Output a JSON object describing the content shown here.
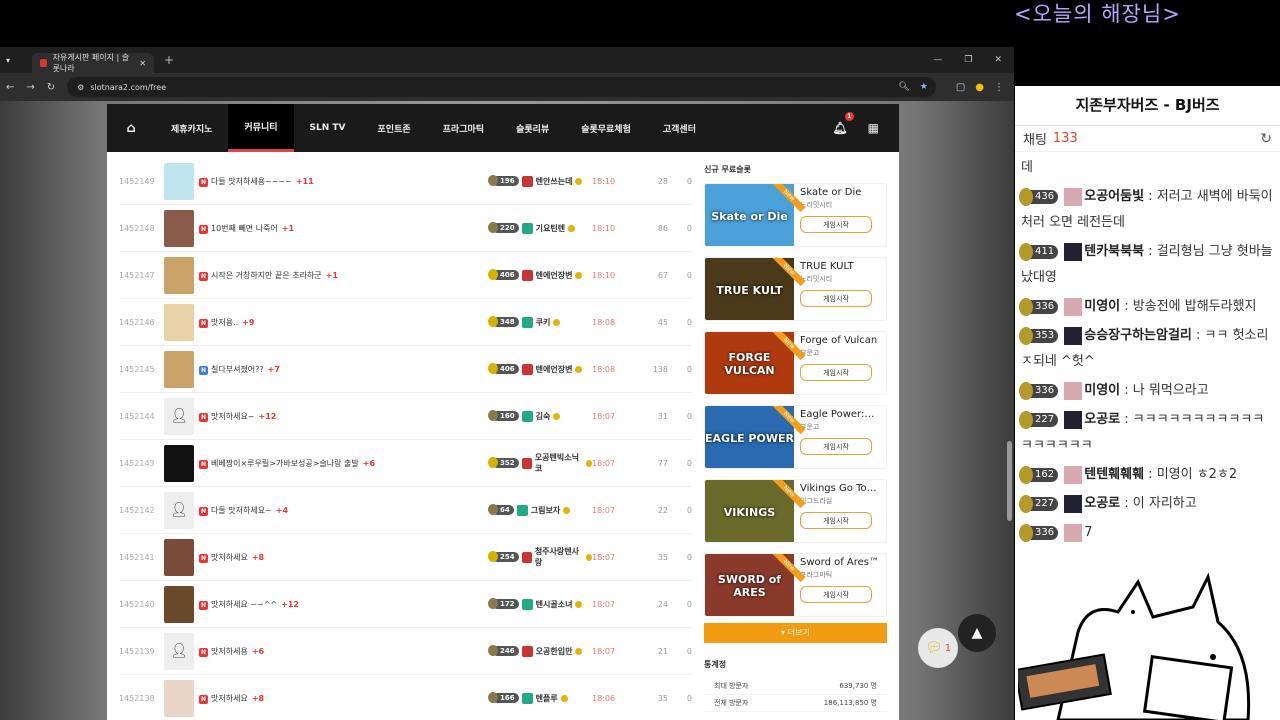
{
  "overlay": {
    "title": "<오늘의 해장님>"
  },
  "browser": {
    "tab_title": "자유게시판 페이지 | 슬롯나라",
    "url": "slotnara2.com/free"
  },
  "nav": {
    "items": [
      "제휴카지노",
      "커뮤니티",
      "SLN TV",
      "포인트존",
      "프라그마틱",
      "슬롯리뷰",
      "슬롯무료체험",
      "고객센터"
    ],
    "active": "커뮤니티",
    "bell_count": "1"
  },
  "posts": [
    {
      "num": "1452149",
      "badge": "N",
      "title": "다들 맛저하세용~~~~",
      "count": "+11",
      "level": "196",
      "author": "텐안쓰는데",
      "time": "18:10",
      "views": "28",
      "likes": "0",
      "thumb": "#bfe6ef"
    },
    {
      "num": "1452148",
      "badge": "N",
      "title": "10번째 뻬면 나죽어",
      "count": "+1",
      "level": "220",
      "author": "기요틴텐",
      "time": "18:10",
      "views": "86",
      "likes": "0",
      "thumb": "#8a5b4a"
    },
    {
      "num": "1452147",
      "badge": "N",
      "title": "시작은 거창하지만 끝은 초라하군",
      "count": "+1",
      "level": "406",
      "author": "텐에언장변",
      "time": "18:10",
      "views": "67",
      "likes": "0",
      "thumb": "#c9a36a"
    },
    {
      "num": "1452146",
      "badge": "N",
      "title": "맛저용..",
      "count": "+9",
      "level": "348",
      "author": "쿠키",
      "time": "18:08",
      "views": "45",
      "likes": "0",
      "thumb": "#e8d2a8"
    },
    {
      "num": "1452145",
      "badge": "N",
      "title": "칠다부셔졌어??",
      "count": "+7",
      "level": "406",
      "author": "텐에언장변",
      "time": "18:08",
      "views": "138",
      "likes": "0",
      "thumb": "#c9a36a",
      "blue": true
    },
    {
      "num": "1452144",
      "badge": "N",
      "title": "맛저하세요~",
      "count": "+12",
      "level": "160",
      "author": "김숙",
      "time": "18:07",
      "views": "31",
      "likes": "0",
      "thumb": "#eeeeee"
    },
    {
      "num": "1452143",
      "badge": "N",
      "title": "베베짱이×루우릴>가바보성공>슬나랑 출발",
      "count": "+6",
      "level": "352",
      "author": "오공텐빅소닉코",
      "time": "18:07",
      "views": "77",
      "likes": "0",
      "thumb": "#111111"
    },
    {
      "num": "1452142",
      "badge": "N",
      "title": "다들 맛저하세요~",
      "count": "+4",
      "level": "64",
      "author": "그림보자",
      "time": "18:07",
      "views": "22",
      "likes": "0",
      "thumb": "#eeeeee"
    },
    {
      "num": "1452141",
      "badge": "N",
      "title": "맛저하세요",
      "count": "+8",
      "level": "254",
      "author": "청주사랑텐사랑",
      "time": "18:07",
      "views": "35",
      "likes": "0",
      "thumb": "#7a4a3a"
    },
    {
      "num": "1452140",
      "badge": "N",
      "title": "맛저하세요 ~~^^",
      "count": "+12",
      "level": "172",
      "author": "텐시골소녀",
      "time": "18:07",
      "views": "24",
      "likes": "0",
      "thumb": "#6a4a2a"
    },
    {
      "num": "1452139",
      "badge": "N",
      "title": "맛저하세용",
      "count": "+6",
      "level": "246",
      "author": "오공한입만",
      "time": "18:07",
      "views": "21",
      "likes": "0",
      "thumb": "#eeeeee"
    },
    {
      "num": "1452138",
      "badge": "N",
      "title": "맛저하세요",
      "count": "+8",
      "level": "166",
      "author": "텐플루",
      "time": "18:06",
      "views": "35",
      "likes": "0",
      "thumb": "#e9d6c8"
    }
  ],
  "sidebar": {
    "heading": "신규 무료슬롯",
    "games": [
      {
        "name": "Skate or Die",
        "provider": "노리밋시티",
        "button": "게임시작",
        "art": "Skate or Die",
        "color": "#4aa0d8",
        "ribbon": "New"
      },
      {
        "name": "TRUE KULT",
        "provider": "노리밋시티",
        "button": "게임시작",
        "art": "TRUE KULT",
        "color": "#4a3a1a",
        "ribbon": "New"
      },
      {
        "name": "Forge of Vulcan",
        "provider": "부운고",
        "button": "게임시작",
        "art": "FORGE VULCAN",
        "color": "#b03a10",
        "ribbon": "New"
      },
      {
        "name": "Eagle Power:…",
        "provider": "부운고",
        "button": "게임시작",
        "art": "EAGLE POWER",
        "color": "#2a6ab0",
        "ribbon": "New"
      },
      {
        "name": "Vikings Go To…",
        "provider": "이그드라실",
        "button": "게임시작",
        "art": "VIKINGS",
        "color": "#6a6a2a",
        "ribbon": "New"
      },
      {
        "name": "Sword of Ares™",
        "provider": "프라그마틱",
        "button": "게임시작",
        "art": "SWORD of ARES",
        "color": "#8a3a2a",
        "ribbon": "New"
      }
    ],
    "more_label": "더보기",
    "stats_heading": "통계정",
    "stats": [
      {
        "label": "최대 방문자",
        "value": "639,730 명"
      },
      {
        "label": "전체 방문자",
        "value": "186,113,850 명"
      }
    ]
  },
  "chat_fab_count": "1",
  "chat": {
    "title": "지존부자버즈 - BJ버즈",
    "label": "채팅",
    "count": "133",
    "messages": [
      {
        "level": "",
        "nick": "",
        "text": "데"
      },
      {
        "level": "436",
        "nick": "오공어둠빛",
        "text": "저러고 새벽에 바둑이처러 오면 레전든데"
      },
      {
        "level": "411",
        "nick": "텐카북북북",
        "text": "걸리형님 그냥 혓바늘났대영"
      },
      {
        "level": "336",
        "nick": "미영이",
        "text": "방송전에 밥해두라했지"
      },
      {
        "level": "353",
        "nick": "승승장구하는암걸리",
        "text": "ㅋㅋ 헛소리 ㅈ되네 ^헛^"
      },
      {
        "level": "336",
        "nick": "미영이",
        "text": "나 뭐먹으라고"
      },
      {
        "level": "227",
        "nick": "오공로",
        "text": "ㅋㅋㅋㅋㅋㅋㅋㅋㅋㅋㅋㅋㅋㅋㅋㅋㅋ"
      },
      {
        "level": "162",
        "nick": "텐텐훼훼훼",
        "text": "미영이 ㅎ2ㅎ2"
      },
      {
        "level": "227",
        "nick": "오공로",
        "text": "이 자리하고"
      },
      {
        "level": "336",
        "nick": "",
        "text": "7"
      }
    ]
  }
}
